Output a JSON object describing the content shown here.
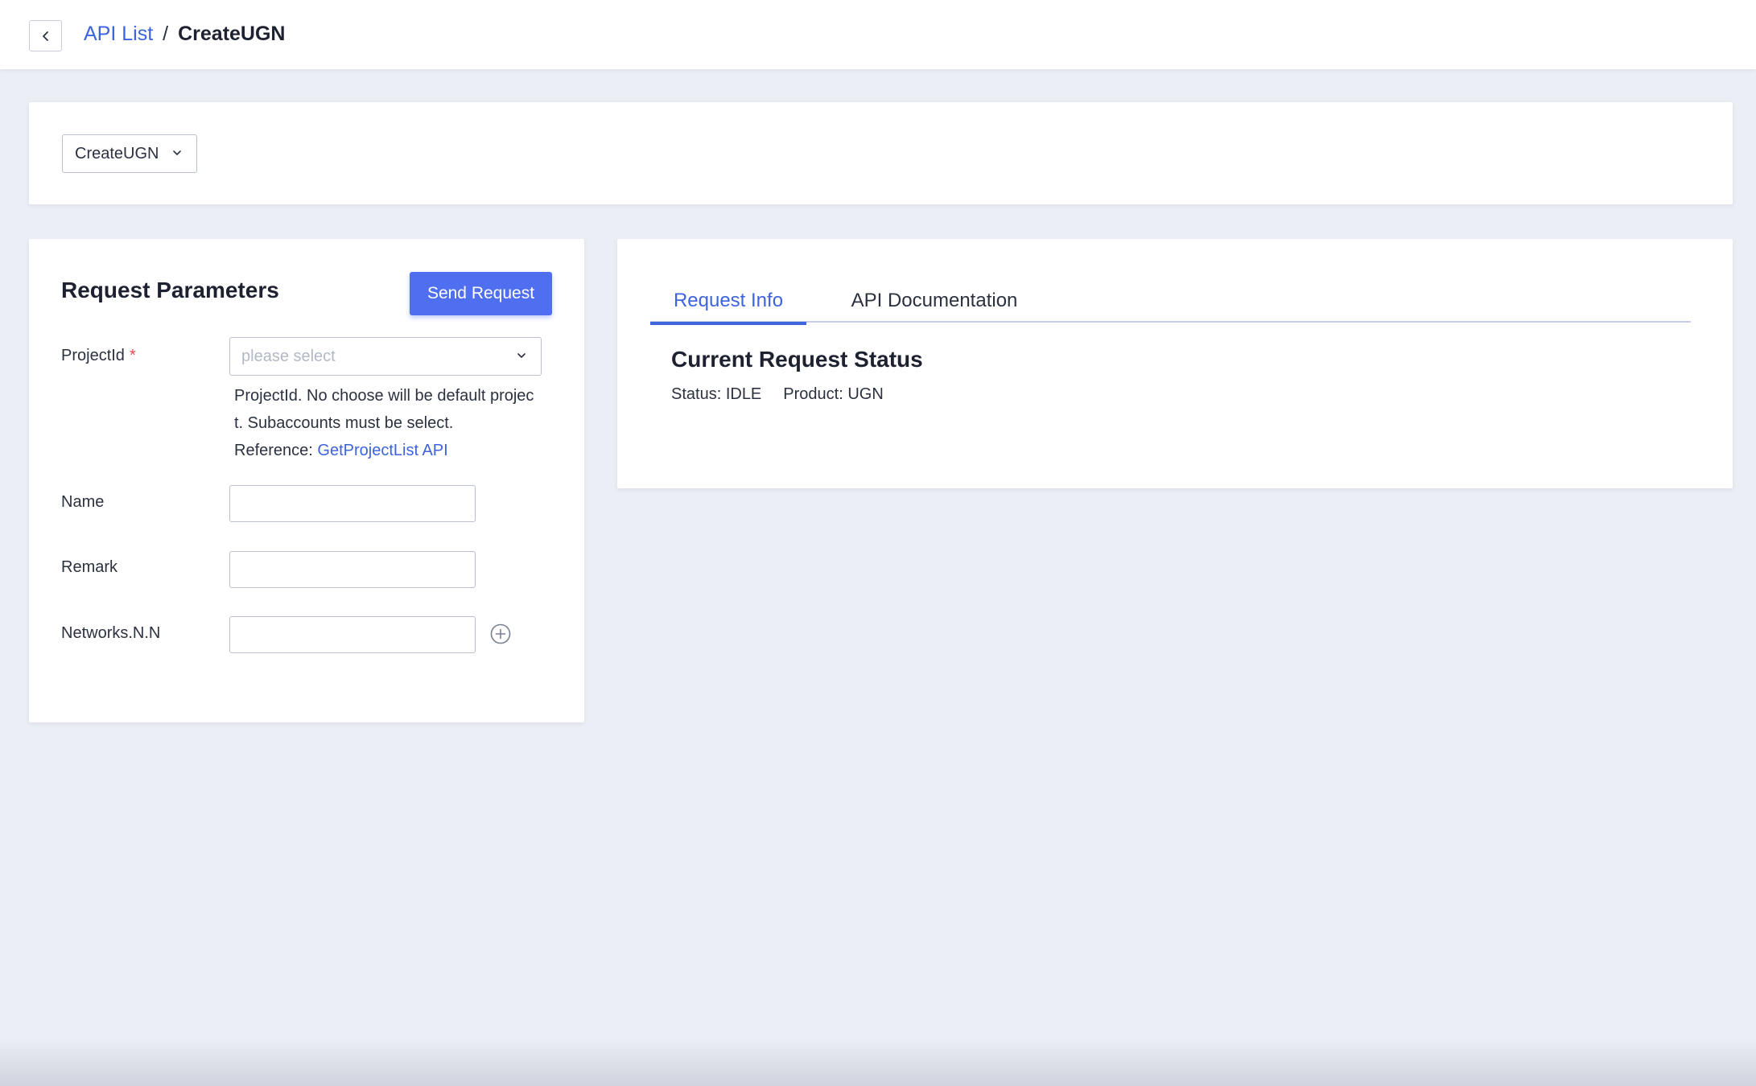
{
  "breadcrumb": {
    "parent": "API List",
    "separator": "/",
    "current": "CreateUGN"
  },
  "api_selector": {
    "value": "CreateUGN"
  },
  "params": {
    "title": "Request Parameters",
    "send_label": "Send Request",
    "project_id": {
      "label": "ProjectId",
      "required_mark": "*",
      "placeholder": "please select",
      "help_line1": "ProjectId. No choose will be default projec",
      "help_line2": "t. Subaccounts must be select.",
      "help_ref_prefix": "Reference: ",
      "help_ref_link": "GetProjectList API"
    },
    "name": {
      "label": "Name",
      "value": ""
    },
    "remark": {
      "label": "Remark",
      "value": ""
    },
    "networks": {
      "label": "Networks.N.N",
      "value": ""
    }
  },
  "info": {
    "tabs": [
      {
        "label": "Request Info",
        "active": true
      },
      {
        "label": "API Documentation",
        "active": false
      }
    ],
    "status_title": "Current Request Status",
    "status_text": "Status: IDLE",
    "product_text": "Product: UGN"
  },
  "colors": {
    "accent": "#3d63dd",
    "button": "#4f6ef0",
    "background": "#eceef6",
    "required": "#e5484d"
  },
  "icons": {
    "back": "chevron-left-icon",
    "dropdown": "chevron-down-icon",
    "add": "plus-circle-icon"
  }
}
